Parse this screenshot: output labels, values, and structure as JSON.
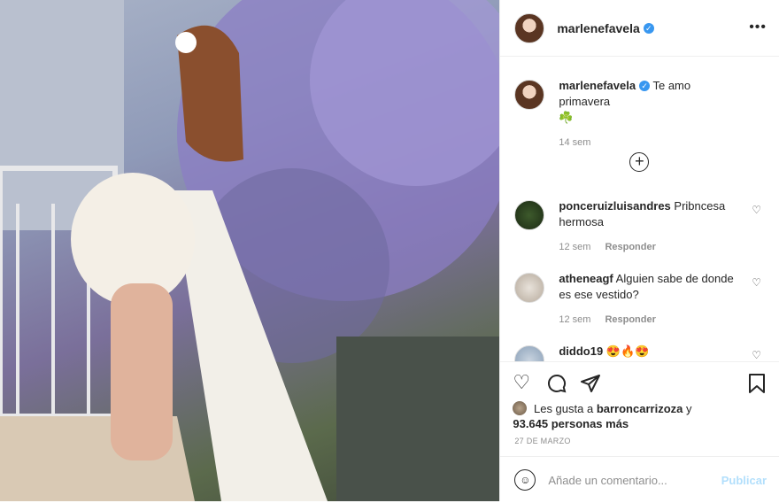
{
  "post": {
    "username": "marlenefavela",
    "caption_text": "Te amo primavera",
    "caption_emoji": "☘️",
    "caption_time": "14 sem",
    "comments": [
      {
        "user": "ponceruizluisandres",
        "text": "Pribncesa hermosa",
        "time": "12 sem",
        "reply": "Responder"
      },
      {
        "user": "atheneagf",
        "text": "Alguien sabe de donde es ese vestido?",
        "time": "12 sem",
        "reply": "Responder"
      },
      {
        "user": "diddo19",
        "text": "😍🔥😍",
        "time": "",
        "reply": ""
      }
    ],
    "likes_prefix": "Les gusta a",
    "likes_user": "barroncarrizoza",
    "likes_and": "y",
    "likes_count": "93.645 personas más",
    "date": "27 DE MARZO",
    "add_comment_placeholder": "Añade un comentario...",
    "publish_label": "Publicar"
  },
  "icons": {
    "more": "more-icon",
    "verified": "verified-badge-icon",
    "like": "heart-icon",
    "comment": "comment-icon",
    "share": "share-icon",
    "save": "bookmark-icon",
    "emoji": "emoji-icon",
    "plus": "plus-circle-icon"
  },
  "colors": {
    "accent": "#3897f0",
    "publish_disabled": "#b2dffc",
    "meta": "#8e8e8e"
  }
}
